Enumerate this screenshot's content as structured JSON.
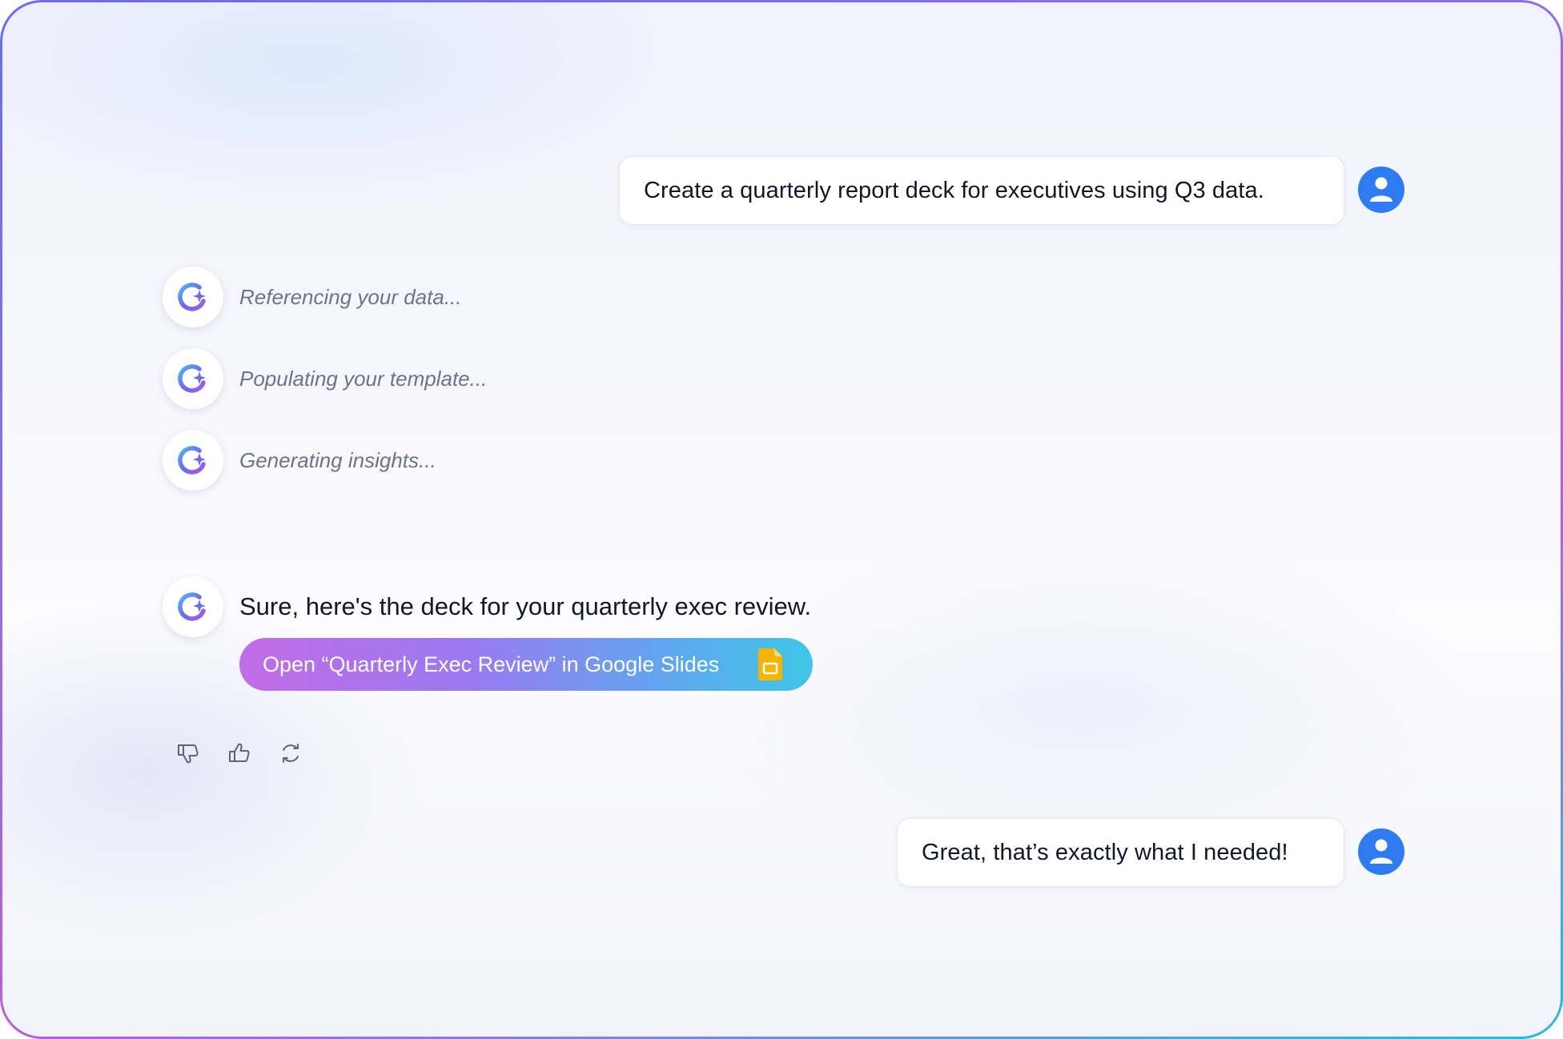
{
  "conversation": {
    "user_messages": [
      {
        "text": "Create a quarterly report deck for executives using Q3 data."
      },
      {
        "text": "Great, that’s exactly what I needed!"
      }
    ],
    "status_steps": [
      {
        "text": "Referencing your data..."
      },
      {
        "text": "Populating your template..."
      },
      {
        "text": "Generating insights..."
      }
    ],
    "assistant_reply": {
      "text": "Sure, here's the deck for your quarterly exec review.",
      "open_button_label": "Open “Quarterly Exec Review” in Google Slides",
      "open_button_icon": "google-slides-icon"
    },
    "actions": [
      {
        "icon": "thumbs-down-icon"
      },
      {
        "icon": "thumbs-up-icon"
      },
      {
        "icon": "regenerate-icon"
      }
    ]
  },
  "colors": {
    "user_avatar": "#2f7cf2",
    "button_gradient_start": "#c16ce6",
    "button_gradient_end": "#3fc6e6",
    "slides_icon": "#f4b400"
  }
}
